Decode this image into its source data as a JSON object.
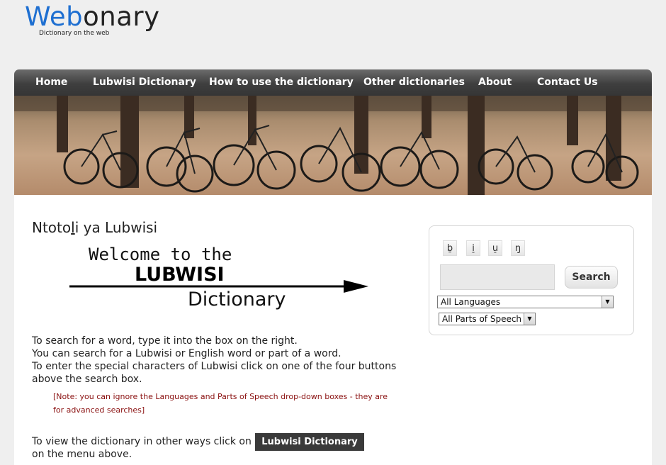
{
  "site": {
    "logo_part1": "Web",
    "logo_part2": "onary",
    "tagline": "Dictionary on the web"
  },
  "nav": {
    "items": [
      {
        "label": "Home"
      },
      {
        "label": "Lubwisi Dictionary"
      },
      {
        "label": "How to use the dictionary"
      },
      {
        "label": "Other dictionaries"
      },
      {
        "label": "About"
      },
      {
        "label": "Contact Us"
      }
    ]
  },
  "main": {
    "title_part1": "Ntoto",
    "title_underlined": "l",
    "title_part2": "i ya Lubwisi",
    "welcome_line1": "Welcome to the",
    "welcome_line2": "LUBWISI",
    "welcome_line3": "Dictionary",
    "intro_lines": [
      "To search for a word, type it into the box on the right.",
      "You can search for a Lubwisi or English word or part of a word.",
      "To enter the special characters of Lubwisi click on one of the four buttons",
      "above the search box."
    ],
    "note_lines": [
      "[Note: you can ignore the Languages and Parts of Speech drop-down boxes - they are",
      "for advanced searches]"
    ],
    "view_text": "To view the dictionary in other ways click on",
    "view_button": "Lubwisi Dictionary",
    "view_text2": "on the menu above."
  },
  "search": {
    "char_buttons": [
      "ḇ",
      "i̠",
      "u̠",
      "ŋ"
    ],
    "input_value": "",
    "button_label": "Search",
    "languages_selected": "All Languages",
    "pos_selected": "All Parts of Speech"
  },
  "colors": {
    "logo_accent": "#1e6fd1",
    "nav_bg": "#3f3f3f",
    "note_text": "#8a1010"
  }
}
